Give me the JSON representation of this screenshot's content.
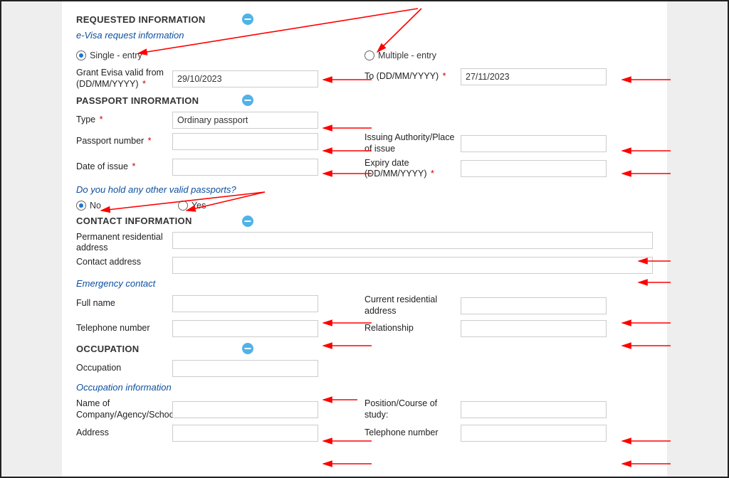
{
  "sections": {
    "requested": {
      "title": "REQUESTED INFORMATION"
    },
    "passport": {
      "title": "PASSPORT INRORMATION"
    },
    "contact": {
      "title": "CONTACT INFORMATION"
    },
    "occupation": {
      "title": "OCCUPATION"
    }
  },
  "subheads": {
    "evisa_req": "e-Visa request information",
    "other_passports": "Do you hold any other valid passports?",
    "emergency": "Emergency contact",
    "occ_info": "Occupation information"
  },
  "labels": {
    "single_entry": "Single - entry",
    "multiple_entry": "Multiple - entry",
    "valid_from": "Grant Evisa valid from (DD/MM/YYYY)",
    "valid_to": "To (DD/MM/YYYY)",
    "type": "Type",
    "passport_number": "Passport number",
    "issuing_authority": "Issuing Authority/Place of issue",
    "date_of_issue": "Date of issue",
    "expiry_date": "Expiry date (DD/MM/YYYY)",
    "no": "No",
    "yes": "Yes",
    "perm_addr": "Permanent residential address",
    "contact_addr": "Contact address",
    "full_name": "Full name",
    "curr_addr": "Current residential address",
    "telephone": "Telephone number",
    "relationship": "Relationship",
    "occupation": "Occupation",
    "company": "Name of Company/Agency/School",
    "position": "Position/Course of study:",
    "address": "Address"
  },
  "values": {
    "valid_from": "29/10/2023",
    "valid_to": "27/11/2023",
    "passport_type": "Ordinary passport"
  },
  "required_marker": "*"
}
